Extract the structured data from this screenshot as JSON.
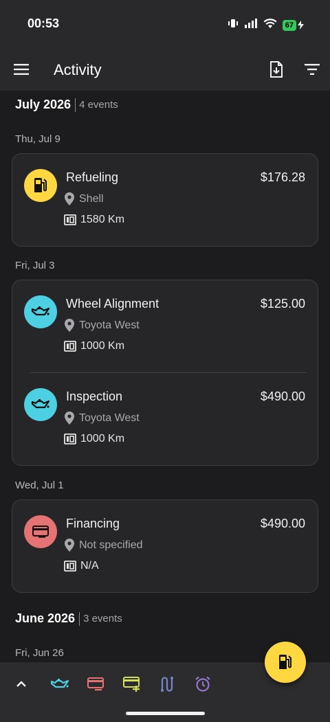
{
  "status_bar": {
    "time": "00:53",
    "battery": "67"
  },
  "app_bar": {
    "title": "Activity"
  },
  "months": [
    {
      "title": "July 2026",
      "count": "4 events"
    },
    {
      "title": "June 2026",
      "count": "3 events"
    }
  ],
  "days": [
    {
      "label": "Thu, Jul 9"
    },
    {
      "label": "Fri, Jul 3"
    },
    {
      "label": "Wed, Jul 1"
    },
    {
      "label": "Fri, Jun 26"
    }
  ],
  "entries": [
    {
      "title": "Refueling",
      "amount": "$176.28",
      "location": "Shell",
      "odometer": "1580 Km",
      "icon": "fuel-pump-icon",
      "color": "#ffd740"
    },
    {
      "title": "Wheel Alignment",
      "amount": "$125.00",
      "location": "Toyota West",
      "odometer": "1000 Km",
      "icon": "oil-can-icon",
      "color": "#4dd0e1"
    },
    {
      "title": "Inspection",
      "amount": "$490.00",
      "location": "Toyota West",
      "odometer": "1000 Km",
      "icon": "oil-can-icon",
      "color": "#4dd0e1"
    },
    {
      "title": "Financing",
      "amount": "$490.00",
      "location": "Not specified",
      "odometer": "N/A",
      "icon": "credit-card-icon",
      "color": "#e57373"
    }
  ],
  "bottom_bar": {
    "items": [
      {
        "icon": "chevron-up-icon",
        "color": "#f2f2f2"
      },
      {
        "icon": "oil-can-icon",
        "color": "#4dd0e1"
      },
      {
        "icon": "credit-card-remove-icon",
        "color": "#e57373"
      },
      {
        "icon": "credit-card-add-icon",
        "color": "#d4e157"
      },
      {
        "icon": "route-icon",
        "color": "#7986cb"
      },
      {
        "icon": "alarm-clock-icon",
        "color": "#9575cd"
      }
    ]
  },
  "fab": {
    "icon": "fuel-pump-icon",
    "color": "#ffd740"
  }
}
